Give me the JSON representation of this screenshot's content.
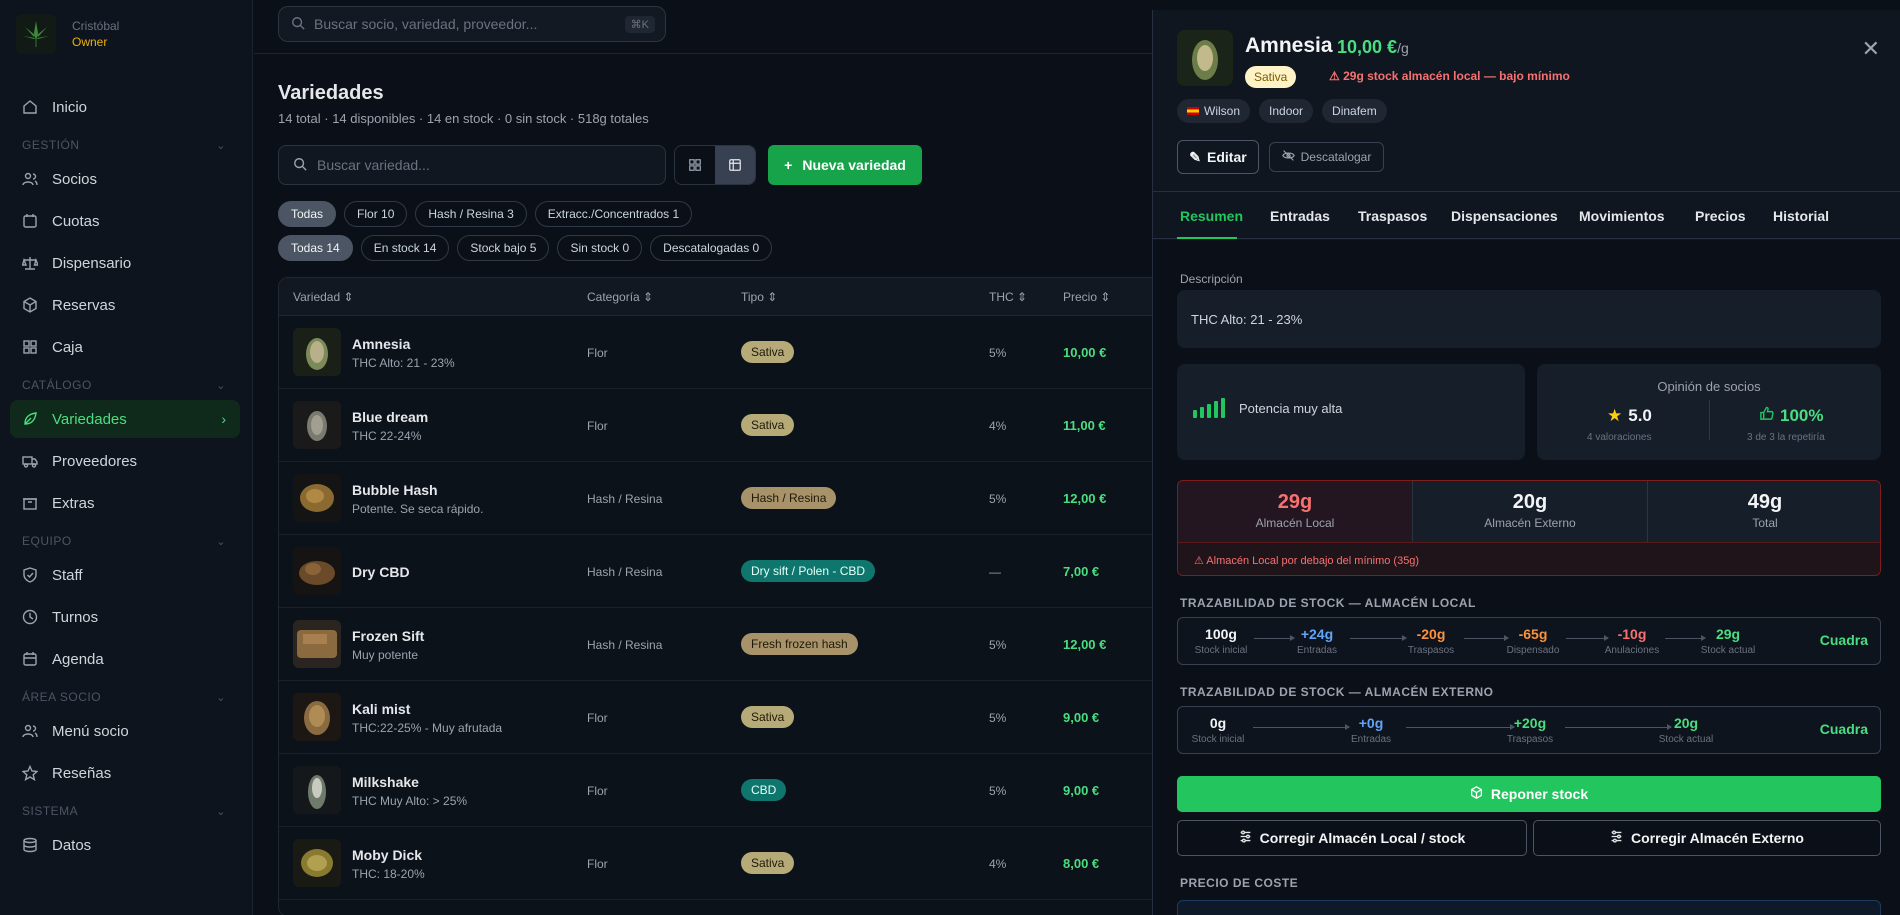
{
  "user": {
    "name": "Cristóbal",
    "role": "Owner"
  },
  "nav": {
    "inicio": "Inicio",
    "gestion": "GESTIÓN",
    "socios": "Socios",
    "cuotas": "Cuotas",
    "dispensario": "Dispensario",
    "reservas": "Reservas",
    "caja": "Caja",
    "catalogo": "CATÁLOGO",
    "variedades": "Variedades",
    "proveedores": "Proveedores",
    "extras": "Extras",
    "equipo": "EQUIPO",
    "staff": "Staff",
    "turnos": "Turnos",
    "agenda": "Agenda",
    "area": "ÁREA SOCIO",
    "menu": "Menú socio",
    "resenas": "Reseñas",
    "sistema": "SISTEMA",
    "datos": "Datos"
  },
  "topbar": {
    "search_placeholder": "Buscar socio, variedad, proveedor...",
    "shortcut": "⌘K"
  },
  "page": {
    "title": "Variedades",
    "subtitle": "14 total · 14 disponibles · 14 en stock · 0 sin stock · 518g totales",
    "search_placeholder": "Buscar variedad...",
    "new_button": "Nueva variedad"
  },
  "filters1": [
    "Todas",
    "Flor 10",
    "Hash / Resina 3",
    "Extracc./Concentrados 1"
  ],
  "filters2": [
    "Todas 14",
    "En stock 14",
    "Stock bajo 5",
    "Sin stock 0",
    "Descatalogadas 0"
  ],
  "columns": {
    "variedad": "Variedad",
    "categoria": "Categoría",
    "tipo": "Tipo",
    "thc": "THC",
    "precio": "Precio"
  },
  "rows": [
    {
      "name": "Amnesia",
      "desc": "THC Alto: 21 - 23%",
      "cat": "Flor",
      "tipo": "Sativa",
      "thc": "5%",
      "price": "10,00 €"
    },
    {
      "name": "Blue dream",
      "desc": "THC 22-24%",
      "cat": "Flor",
      "tipo": "Sativa",
      "thc": "4%",
      "price": "11,00 €"
    },
    {
      "name": "Bubble Hash",
      "desc": "Potente. Se seca rápido.",
      "cat": "Hash / Resina",
      "tipo": "Hash / Resina",
      "thc": "5%",
      "price": "12,00 €"
    },
    {
      "name": "Dry CBD",
      "desc": "",
      "cat": "Hash / Resina",
      "tipo": "Dry sift / Polen - CBD",
      "thc": "—",
      "price": "7,00 €"
    },
    {
      "name": "Frozen Sift",
      "desc": "Muy potente",
      "cat": "Hash / Resina",
      "tipo": "Fresh frozen hash",
      "thc": "5%",
      "price": "12,00 €"
    },
    {
      "name": "Kali mist",
      "desc": "THC:22-25% - Muy afrutada",
      "cat": "Flor",
      "tipo": "Sativa",
      "thc": "5%",
      "price": "9,00 €"
    },
    {
      "name": "Milkshake",
      "desc": "THC Muy Alto: > 25%",
      "cat": "Flor",
      "tipo": "CBD",
      "thc": "5%",
      "price": "9,00 €"
    },
    {
      "name": "Moby Dick",
      "desc": "THC: 18-20%",
      "cat": "Flor",
      "tipo": "Sativa",
      "thc": "4%",
      "price": "8,00 €"
    }
  ],
  "panel": {
    "name": "Amnesia",
    "price": "10,00 €",
    "unit": "/g",
    "badge": "Sativa",
    "warning": "⚠ 29g stock almacén local — bajo mínimo",
    "tags": [
      "Wilson",
      "Indoor",
      "Dinafem"
    ],
    "edit": "Editar",
    "discontinue": "Descatalogar",
    "tabs": [
      "Resumen",
      "Entradas",
      "Traspasos",
      "Dispensaciones",
      "Movimientos",
      "Precios",
      "Historial"
    ],
    "desc_label": "Descripción",
    "desc_value": "THC Alto: 21 - 23%",
    "potency": "Potencia muy alta",
    "opinion_title": "Opinión de socios",
    "rating": "5.0",
    "ratings_count": "4 valoraciones",
    "repeat": "100%",
    "repeat_sub": "3 de 3 la repetiría",
    "stock_local": "29g",
    "stock_local_label": "Almacén Local",
    "stock_ext": "20g",
    "stock_ext_label": "Almacén Externo",
    "stock_total": "49g",
    "stock_total_label": "Total",
    "stock_alert": "⚠ Almacén Local por debajo del mínimo (35g)",
    "trace_local_title": "TRAZABILIDAD DE STOCK — ALMACÉN LOCAL",
    "trace_local": [
      {
        "v": "100g",
        "l": "Stock inicial"
      },
      {
        "v": "+24g",
        "l": "Entradas"
      },
      {
        "v": "-20g",
        "l": "Traspasos"
      },
      {
        "v": "-65g",
        "l": "Dispensado"
      },
      {
        "v": "-10g",
        "l": "Anulaciones"
      },
      {
        "v": "29g",
        "l": "Stock actual"
      }
    ],
    "trace_ext_title": "TRAZABILIDAD DE STOCK — ALMACÉN EXTERNO",
    "trace_ext": [
      {
        "v": "0g",
        "l": "Stock inicial"
      },
      {
        "v": "+0g",
        "l": "Entradas"
      },
      {
        "v": "+20g",
        "l": "Traspasos"
      },
      {
        "v": "20g",
        "l": "Stock actual"
      }
    ],
    "cuadra": "Cuadra",
    "reponer": "Reponer stock",
    "corr_local": "Corregir Almacén Local / stock",
    "corr_ext": "Corregir Almacén Externo",
    "cost_title": "PRECIO DE COSTE"
  },
  "colors": {
    "accent": "#22c55e",
    "danger": "#f87171",
    "warn": "#fb923c",
    "blue": "#60a5fa"
  }
}
